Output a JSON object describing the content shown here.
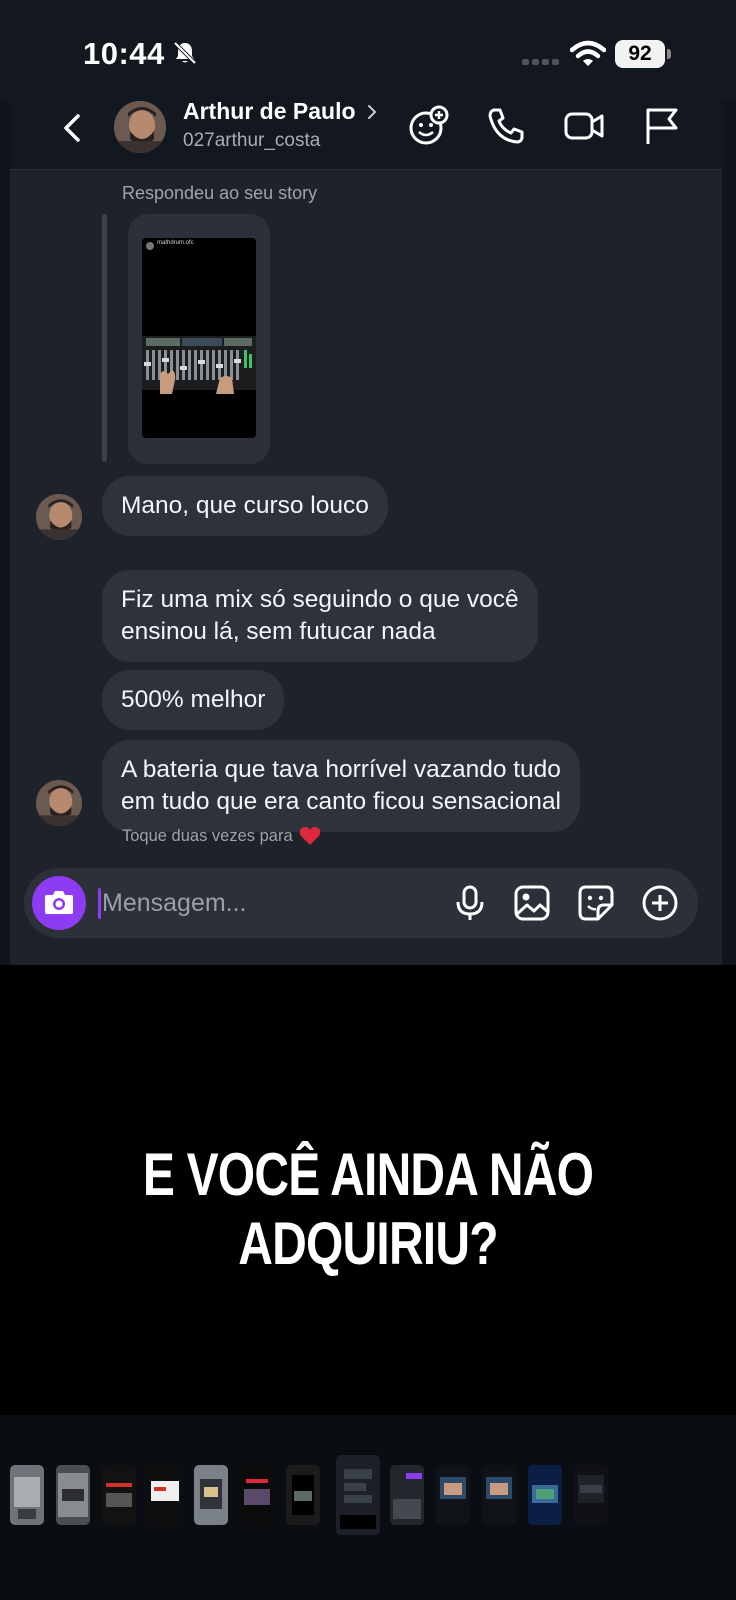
{
  "status_bar": {
    "time": "10:44",
    "battery": "92",
    "icons": [
      "bell-slash-icon",
      "signal-dots-icon",
      "wifi-icon",
      "battery-icon"
    ]
  },
  "header": {
    "contact_name": "Arthur de Paulo",
    "username": "027arthur_costa",
    "icons": [
      "back-chevron-icon",
      "avatar",
      "chevron-right-icon",
      "add-to-chat-icon",
      "phone-icon",
      "video-icon",
      "flag-icon"
    ]
  },
  "story_reply": {
    "label": "Respondeu ao seu story",
    "story_handle": "mathdrum.ofc"
  },
  "messages": [
    {
      "text": "Mano, que curso louco"
    },
    {
      "text": "Fiz uma mix só seguindo o que você\nensinou lá, sem futucar nada"
    },
    {
      "text": "500% melhor"
    },
    {
      "text": "A bateria que tava horrível vazando tudo\nem tudo que era canto ficou sensacional"
    }
  ],
  "reaction_hint": "Toque duas vezes para",
  "composer": {
    "placeholder": "Mensagem...",
    "icons": [
      "camera-icon",
      "microphone-icon",
      "gallery-icon",
      "sticker-icon",
      "plus-icon"
    ]
  },
  "overlay_caption": "E VOCÊ AINDA NÃO ADQUIRIU?",
  "colors": {
    "background": "#10141b",
    "chat_panel": "#1d222b",
    "bubble": "#2d323c",
    "accent_purple": "#8d3cf4",
    "heart_red": "#e0283c"
  }
}
